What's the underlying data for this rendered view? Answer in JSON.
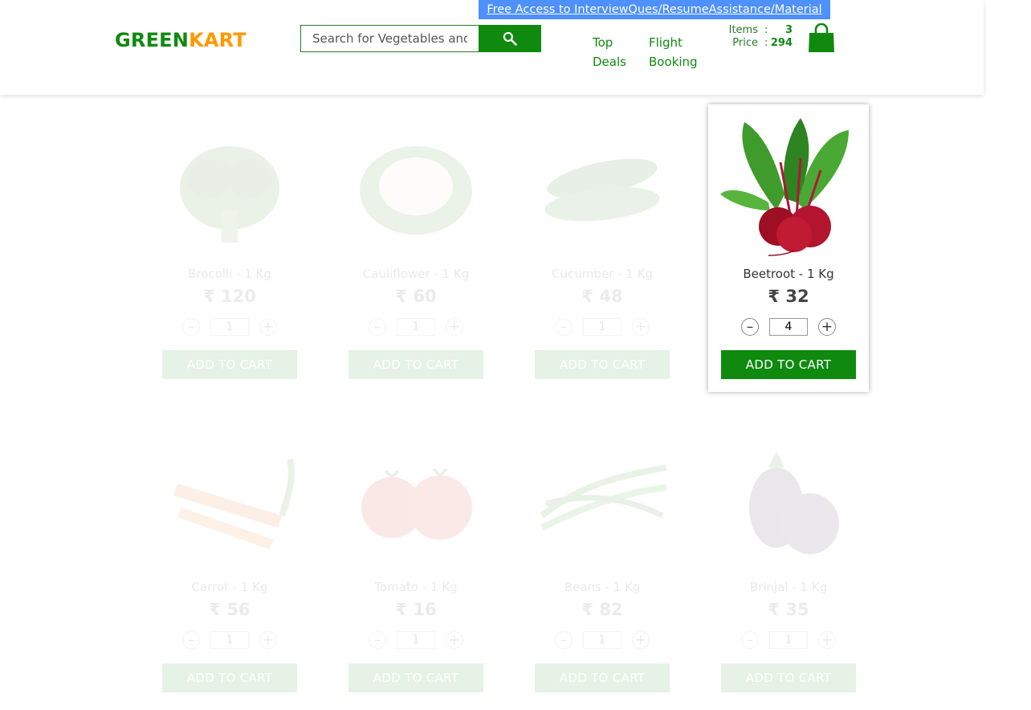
{
  "header": {
    "brand_part1": "GREEN",
    "brand_part2": "KART",
    "search_placeholder": "Search for Vegetables and Fruits",
    "promo_link": "Free Access to InterviewQues/ResumeAssistance/Material",
    "nav": {
      "top_deals": "Top Deals",
      "flight_booking": "Flight Booking"
    },
    "cart": {
      "items_label": "Items",
      "items_value": "3",
      "price_label": "Price",
      "price_value": "294",
      "colon": ":"
    }
  },
  "colors": {
    "brand_green": "#0f8a0f",
    "brand_orange": "#ff9900",
    "promo_blue": "#4d90fe"
  },
  "products": [
    {
      "name": "Brocolli - 1 Kg",
      "price": "₹ 120",
      "quantity": "1",
      "add_label": "ADD TO CART",
      "image": "broccoli"
    },
    {
      "name": "Cauliflower - 1 Kg",
      "price": "₹ 60",
      "quantity": "1",
      "add_label": "ADD TO CART",
      "image": "cauliflower"
    },
    {
      "name": "Cucumber - 1 Kg",
      "price": "₹ 48",
      "quantity": "1",
      "add_label": "ADD TO CART",
      "image": "cucumber"
    },
    {
      "name": "Beetroot - 1 Kg",
      "price": "₹ 32",
      "quantity": "4",
      "add_label": "ADD TO CART",
      "image": "beetroot"
    },
    {
      "name": "Carrot - 1 Kg",
      "price": "₹ 56",
      "quantity": "1",
      "add_label": "ADD TO CART",
      "image": "carrot"
    },
    {
      "name": "Tomato - 1 Kg",
      "price": "₹ 16",
      "quantity": "1",
      "add_label": "ADD TO CART",
      "image": "tomato"
    },
    {
      "name": "Beans - 1 Kg",
      "price": "₹ 82",
      "quantity": "1",
      "add_label": "ADD TO CART",
      "image": "beans"
    },
    {
      "name": "Brinjal - 1 Kg",
      "price": "₹ 35",
      "quantity": "1",
      "add_label": "ADD TO CART",
      "image": "brinjal"
    }
  ],
  "icons": {
    "search": "search-icon",
    "cart": "shopping-bag-icon",
    "decrement": "minus-icon",
    "increment": "plus-icon"
  }
}
